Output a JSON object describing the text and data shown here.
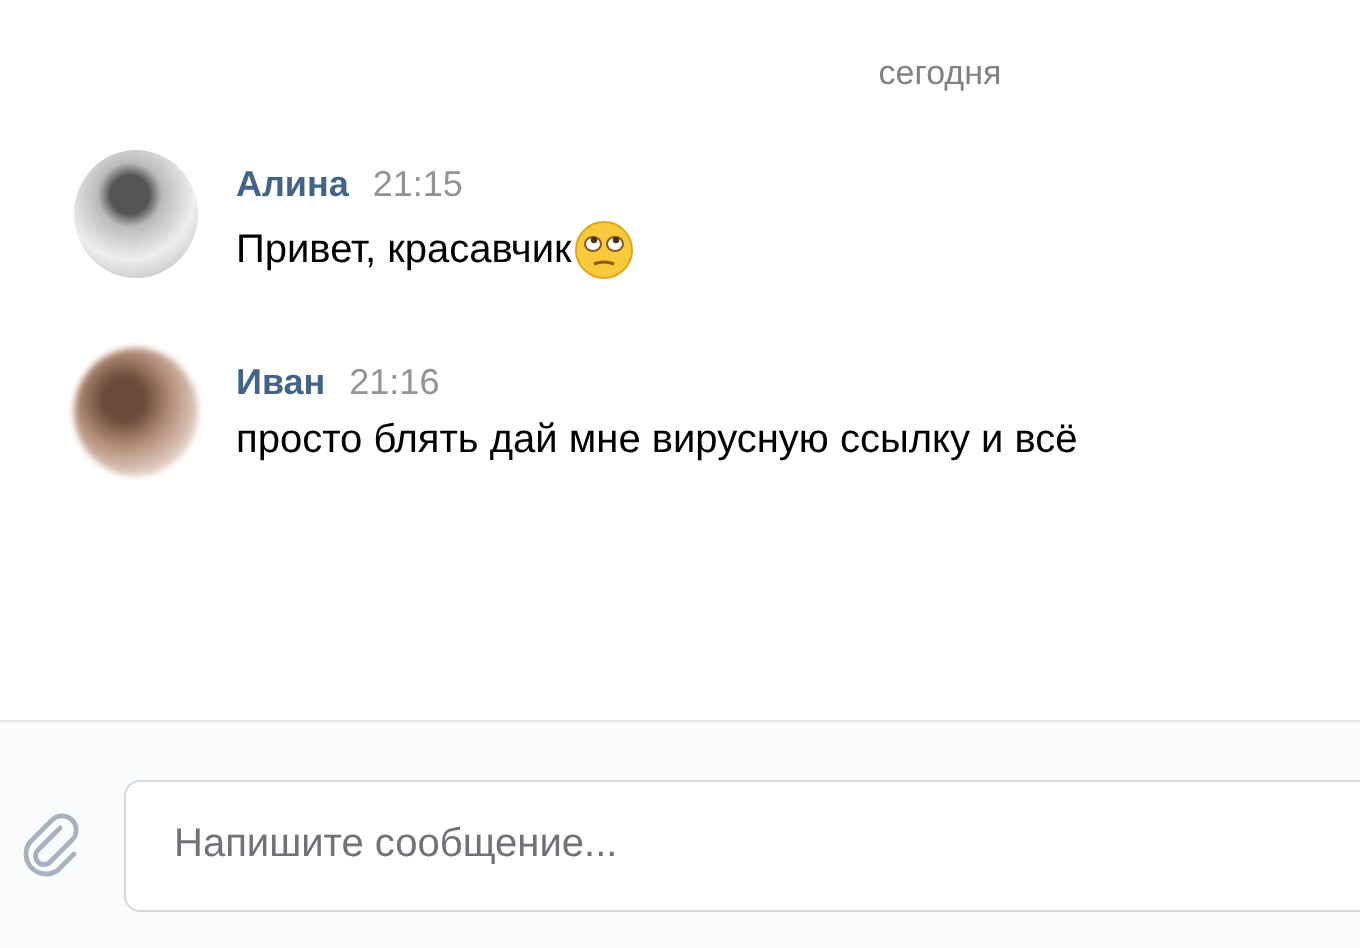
{
  "date_divider": "сегодня",
  "messages": [
    {
      "author": "Алина",
      "time": "21:15",
      "text": "Привет, красавчик",
      "emoji": true,
      "avatar_blurred": false
    },
    {
      "author": "Иван",
      "time": "21:16",
      "text": "просто блять дай мне вирусную ссылку и всё",
      "emoji": false,
      "avatar_blurred": true
    }
  ],
  "composer": {
    "placeholder": "Напишите сообщение..."
  }
}
